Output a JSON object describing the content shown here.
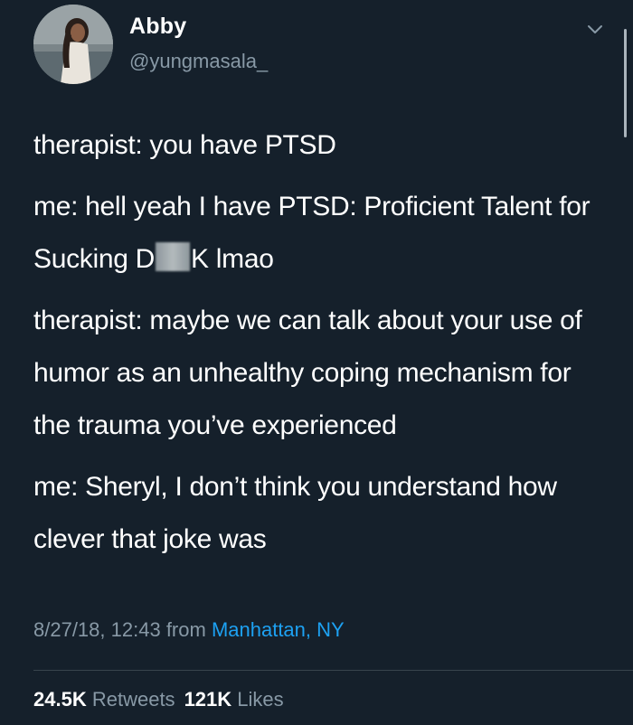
{
  "author": {
    "name": "Abby",
    "handle": "@yungmasala_"
  },
  "tweet": {
    "line1": "therapist: you have PTSD",
    "line2_before": "me: hell yeah I have PTSD: Proficient Talent for Sucking D",
    "line2_after": "K lmao",
    "line3": "therapist: maybe we can talk about your use of humor as an unhealthy coping mechanism for the trauma you’ve experienced",
    "line4": "me: Sheryl, I don’t think you understand how clever that joke was"
  },
  "meta": {
    "timestamp": "8/27/18, 12:43",
    "from_label": "from",
    "location": "Manhattan, NY"
  },
  "stats": {
    "retweets_count": "24.5K",
    "retweets_label": "Retweets",
    "likes_count": "121K",
    "likes_label": "Likes"
  },
  "icons": {
    "menu": "chevron-down-icon"
  },
  "colors": {
    "background": "#15202b",
    "text": "#ffffff",
    "secondary": "#8899a6",
    "link": "#1da1f2"
  }
}
